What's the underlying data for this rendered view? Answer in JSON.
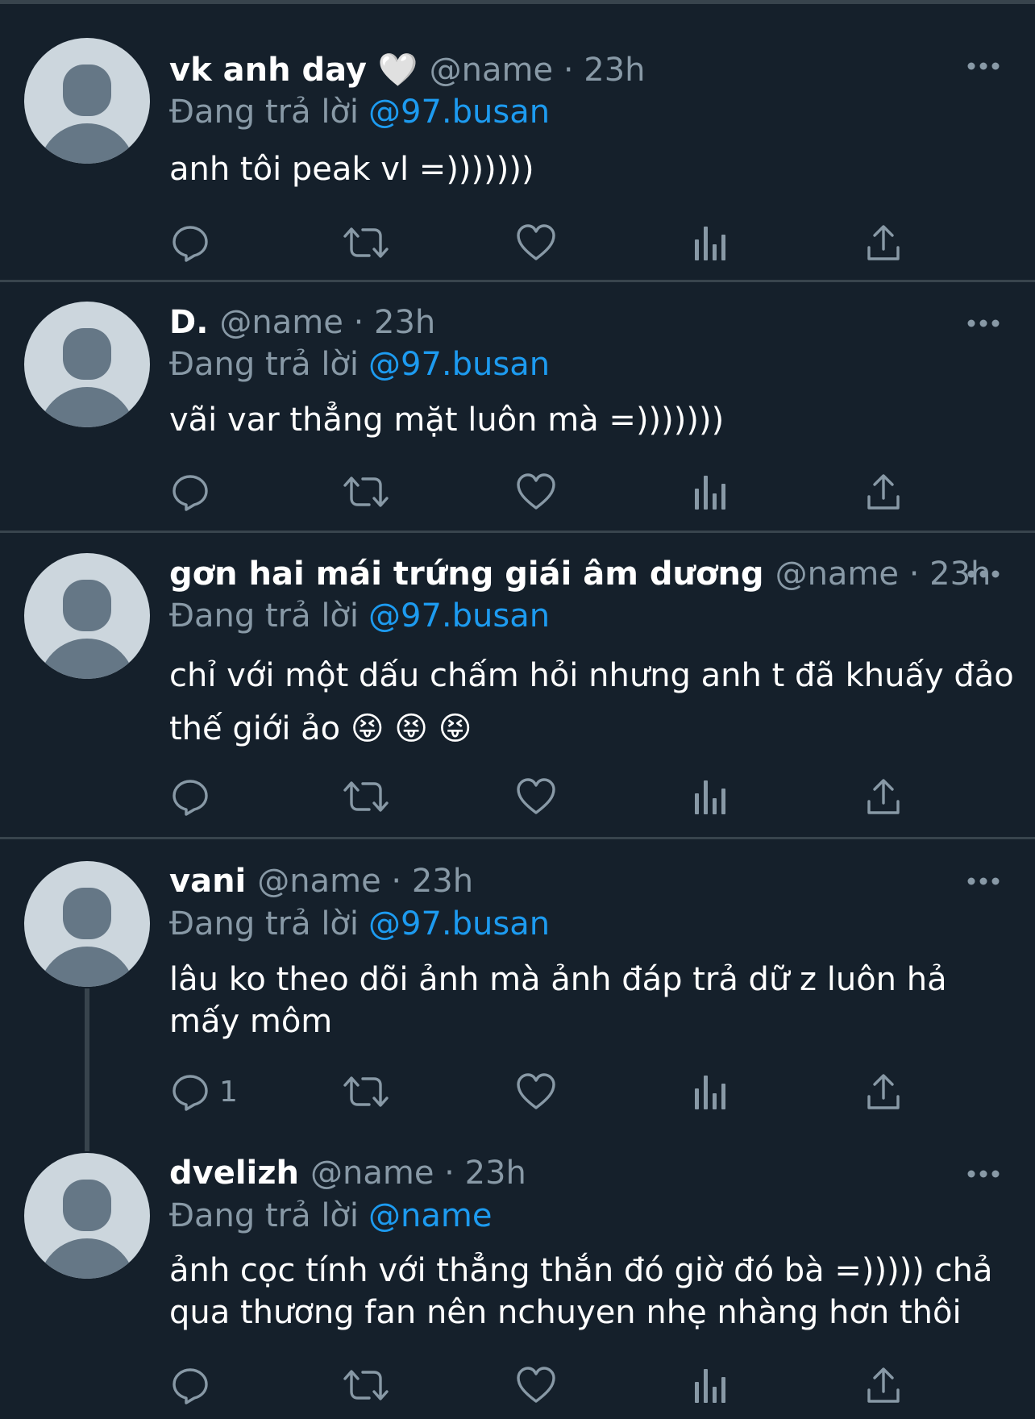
{
  "tweets": [
    {
      "display_name": "vk anh day 🤍",
      "handle": "@name",
      "time": "· 23h",
      "reply_prefix": "Đang trả lời",
      "reply_to": "@97.busan",
      "text": "anh tôi peak vl =)))))))",
      "reply_count": ""
    },
    {
      "display_name": "D.",
      "handle": "@name",
      "time": "· 23h",
      "reply_prefix": "Đang trả lời",
      "reply_to": "@97.busan",
      "text": "vãi var thẳng mặt luôn mà =)))))))",
      "reply_count": ""
    },
    {
      "display_name": "gơn hai mái trứng giái âm dương",
      "handle": "@name",
      "time": "· 23h",
      "reply_prefix": "Đang trả lời",
      "reply_to": "@97.busan",
      "text": "chỉ với một dấu chấm hỏi nhưng anh t đã khuấy đảo thế giới ảo 😝 😝 😝",
      "reply_count": ""
    },
    {
      "display_name": "vani",
      "handle": "@name",
      "time": "· 23h",
      "reply_prefix": "Đang trả lời",
      "reply_to": "@97.busan",
      "text": "lâu ko theo dõi ảnh mà ảnh đáp trả dữ z luôn hả mấy môm",
      "reply_count": "1"
    },
    {
      "display_name": "dvelizh",
      "handle": "@name",
      "time": "· 23h",
      "reply_prefix": "Đang trả lời",
      "reply_to": "@name",
      "text": "ảnh cọc tính với thẳng thắn đó giờ đó bà =))))) chả qua thương fan nên nchuyen nhẹ nhàng hơn thôi",
      "reply_count": ""
    }
  ],
  "icons": {
    "more": "more-horizontal-icon",
    "reply": "reply-bubble-icon",
    "retweet": "retweet-icon",
    "like": "heart-icon",
    "views": "views-bar-chart-icon",
    "share": "share-upload-icon"
  },
  "colors": {
    "background": "#15202b",
    "divider": "#38444d",
    "text": "#ffffff",
    "secondary": "#8899a6",
    "link": "#1d9bf0",
    "avatar_bg": "#ccd6dd",
    "avatar_fg": "#657786"
  }
}
